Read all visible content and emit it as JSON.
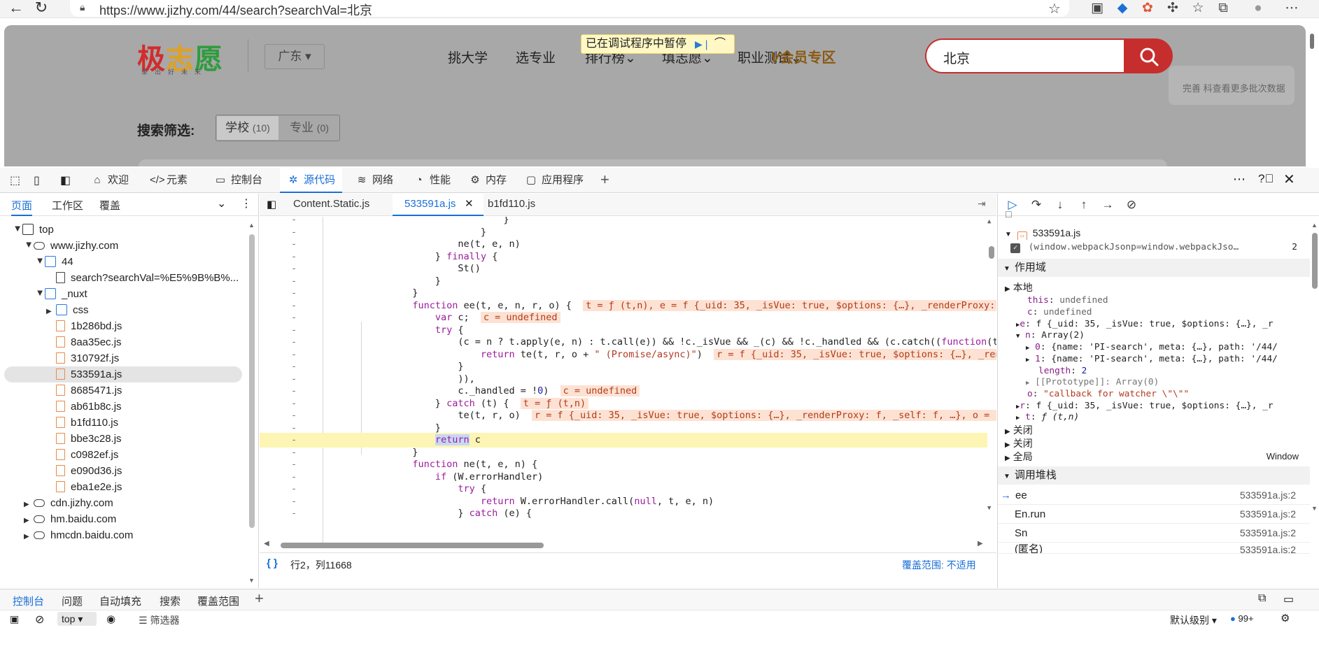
{
  "browser": {
    "url": "https://www.jizhy.com/44/search?searchVal=北京"
  },
  "site": {
    "logo": [
      "极",
      "志",
      "愿"
    ],
    "logo_sub": "录出好未来",
    "province": "广东",
    "nav": [
      "挑大学",
      "选专业",
      "排行榜",
      "填志愿",
      "职业测试"
    ],
    "vip": "会员专区",
    "search_value": "北京",
    "filter_label": "搜索筛选:",
    "filter_school": "学校",
    "filter_school_count": "(10)",
    "filter_major": "专业",
    "filter_major_count": "(0)",
    "side_card_text": "完善 科查看更多批次数据"
  },
  "debug_overlay": {
    "text": "已在调试程序中暂停"
  },
  "devtools": {
    "tabs": [
      "欢迎",
      "元素",
      "控制台",
      "源代码",
      "网络",
      "性能",
      "内存",
      "应用程序"
    ],
    "active_tab": "源代码",
    "navigator": {
      "tabs": [
        "页面",
        "工作区",
        "覆盖"
      ],
      "tree": [
        {
          "label": "top",
          "depth": 0,
          "icon": "frame",
          "open": true
        },
        {
          "label": "www.jizhy.com",
          "depth": 1,
          "icon": "cloud",
          "open": true
        },
        {
          "label": "44",
          "depth": 2,
          "icon": "folder",
          "open": true
        },
        {
          "label": "search?searchVal=%E5%9B%B%...",
          "depth": 3,
          "icon": "doc",
          "open": null
        },
        {
          "label": "_nuxt",
          "depth": 2,
          "icon": "folder",
          "open": true
        },
        {
          "label": "css",
          "depth": 3,
          "icon": "folder",
          "open": false
        },
        {
          "label": "1b286bd.js",
          "depth": 3,
          "icon": "file",
          "open": null
        },
        {
          "label": "8aa35ec.js",
          "depth": 3,
          "icon": "file",
          "open": null
        },
        {
          "label": "310792f.js",
          "depth": 3,
          "icon": "file",
          "open": null
        },
        {
          "label": "533591a.js",
          "depth": 3,
          "icon": "file",
          "open": null
        },
        {
          "label": "8685471.js",
          "depth": 3,
          "icon": "file",
          "open": null
        },
        {
          "label": "ab61b8c.js",
          "depth": 3,
          "icon": "file",
          "open": null
        },
        {
          "label": "b1fd110.js",
          "depth": 3,
          "icon": "file",
          "open": null
        },
        {
          "label": "bbe3c28.js",
          "depth": 3,
          "icon": "file",
          "open": null
        },
        {
          "label": "c0982ef.js",
          "depth": 3,
          "icon": "file",
          "open": null
        },
        {
          "label": "e090d36.js",
          "depth": 3,
          "icon": "file",
          "open": null
        },
        {
          "label": "eba1e2e.js",
          "depth": 3,
          "icon": "file",
          "open": null
        },
        {
          "label": "cdn.jizhy.com",
          "depth": 1,
          "icon": "cloud",
          "open": false
        },
        {
          "label": "hm.baidu.com",
          "depth": 1,
          "icon": "cloud",
          "open": false
        },
        {
          "label": "hmcdn.baidu.com",
          "depth": 1,
          "icon": "cloud",
          "open": false
        }
      ],
      "selected": "533591a.js"
    },
    "editor": {
      "tabs": [
        "Content.Static.js",
        "533591a.js",
        "b1fd110.js"
      ],
      "active_tab": "533591a.js",
      "status_left": "行2，列11668",
      "status_right": "覆盖范围: 不适用"
    },
    "debugger": {
      "breakpoint_file": "533591a.js",
      "breakpoint_line_text": "(window.webpackJsonp=window.webpackJso…",
      "breakpoint_line_no": "2",
      "scope_header": "作用域",
      "local_label": "本地",
      "scope_items": [
        {
          "key": "this",
          "val": "undefined"
        },
        {
          "key": "c",
          "val": "undefined"
        }
      ],
      "e_val": "f {_uid: 35, _isVue: true, $options: {…}, _r",
      "n_val": "Array(2)",
      "n0": "{name: 'PI-search', meta: {…}, path: '/44/",
      "n1": "{name: 'PI-search', meta: {…}, path: '/44/",
      "n_len": "2",
      "n_proto": "[[Prototype]]: Array(0)",
      "o_val": "\"callback for watcher \\\"\\\"\"",
      "r_val": "f {_uid: 35, _isVue: true, $options: {…}, _r",
      "t_val": "ƒ (t,n)",
      "closures": [
        "关闭",
        "关闭"
      ],
      "global_label": "全局",
      "global_val": "Window",
      "callstack_header": "调用堆栈",
      "callstack": [
        {
          "fn": "ee",
          "loc": "533591a.js:2"
        },
        {
          "fn": "En.run",
          "loc": "533591a.js:2"
        },
        {
          "fn": "Sn",
          "loc": "533591a.js:2"
        },
        {
          "fn": "(匿名)",
          "loc": "533591a.js:2"
        }
      ]
    },
    "drawer": {
      "tabs": [
        "控制台",
        "问题",
        "自动填充",
        "搜索",
        "覆盖范围"
      ],
      "context": "top",
      "filter_placeholder": "筛选器",
      "level": "默认级别",
      "count": "99+"
    }
  },
  "colors": {
    "accent": "#1a6ed8",
    "brand_red": "#c62e2e",
    "pause_yellow": "#fff8c5"
  }
}
